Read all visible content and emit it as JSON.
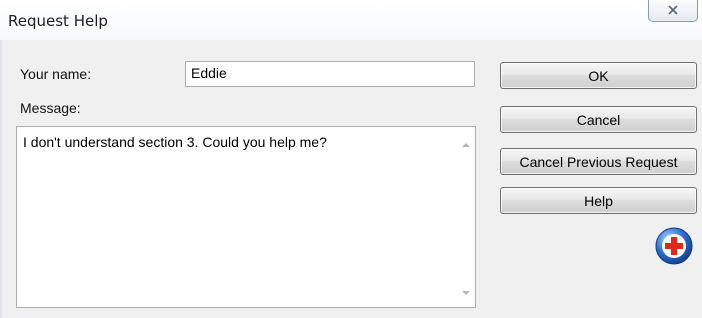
{
  "window": {
    "title": "Request Help",
    "close_icon": "close-x-icon"
  },
  "form": {
    "name_label": "Your name:",
    "name_value": "Eddie",
    "message_label": "Message:",
    "message_value": "I don't understand section 3.  Could you help me?"
  },
  "buttons": {
    "ok": "OK",
    "cancel": "Cancel",
    "cancel_previous": "Cancel Previous Request",
    "help": "Help"
  },
  "icons": {
    "help_badge": "red-cross-help-icon"
  },
  "colors": {
    "help_badge_blue": "#2a6fcf",
    "help_badge_cross": "#e8231a"
  }
}
